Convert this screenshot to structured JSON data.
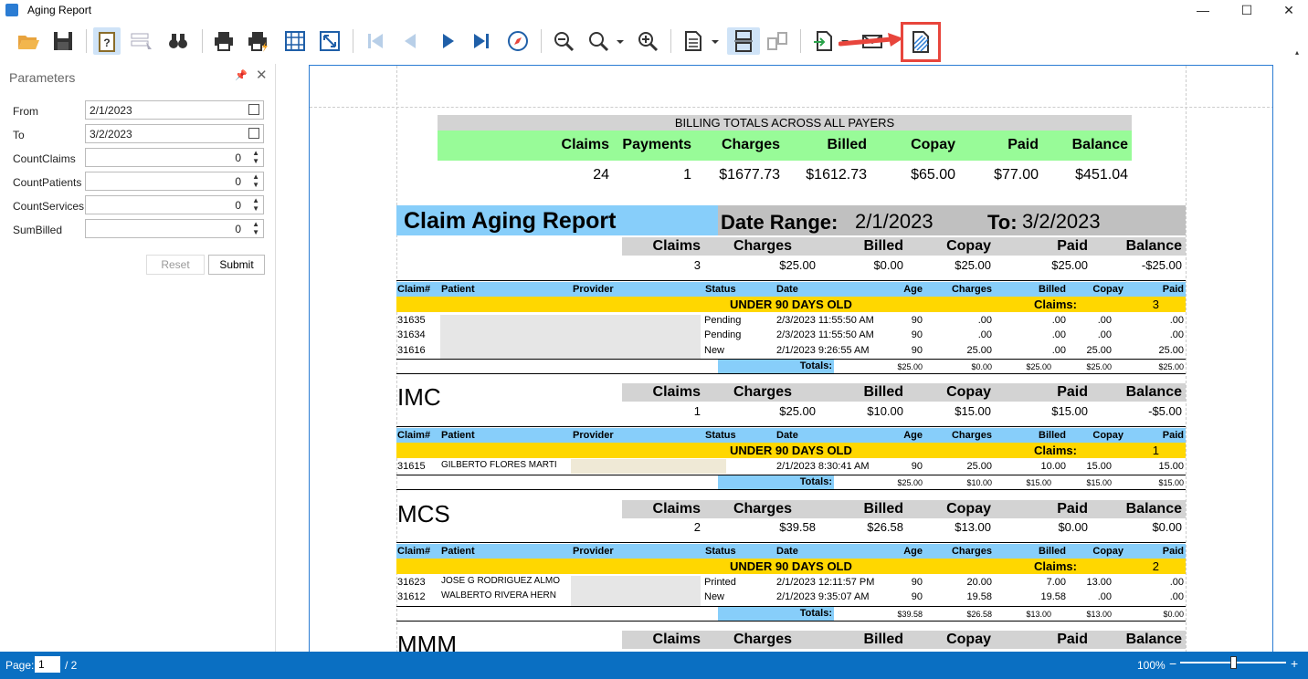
{
  "window": {
    "title": "Aging Report",
    "min": "—",
    "max": "☐",
    "close": "✕"
  },
  "params": {
    "title": "Parameters",
    "pin": "📌",
    "close": "✕",
    "from_label": "From",
    "from_value": "2/1/2023",
    "to_label": "To",
    "to_value": "3/2/2023",
    "countclaims_label": "CountClaims",
    "countclaims_value": "0",
    "countpatients_label": "CountPatients",
    "countpatients_value": "0",
    "countservices_label": "CountServices",
    "countservices_value": "0",
    "sumbilled_label": "SumBilled",
    "sumbilled_value": "0",
    "reset": "Reset",
    "submit": "Submit"
  },
  "report": {
    "billing_title": "BILLING TOTALS ACROSS ALL PAYERS",
    "billing_headers": [
      "Claims",
      "Payments",
      "Charges",
      "Billed",
      "Copay",
      "Paid",
      "Balance"
    ],
    "billing_values": [
      "24",
      "1",
      "$1677.73",
      "$1612.73",
      "$65.00",
      "$77.00",
      "$451.04"
    ],
    "report_title": "Claim Aging Report",
    "date_range_label": "Date Range:",
    "date_from": "2/1/2023",
    "to_label": "To:",
    "date_to": "3/2/2023",
    "sum_headers": [
      "Claims",
      "Charges",
      "Billed",
      "Copay",
      "Paid",
      "Balance"
    ],
    "detail_headers": {
      "claim": "Claim#",
      "patient": "Patient",
      "provider": "Provider",
      "status": "Status",
      "date": "Date",
      "age": "Age",
      "charges": "Charges",
      "billed": "Billed",
      "copay": "Copay",
      "paid": "Paid"
    },
    "band_label": "UNDER 90 DAYS OLD",
    "band_claims_label": "Claims:",
    "totals_label": "Totals:",
    "groups": [
      {
        "name": "",
        "summary": [
          "3",
          "$25.00",
          "$0.00",
          "$25.00",
          "$25.00",
          "-$25.00"
        ],
        "band_count": "3",
        "rows": [
          {
            "claim": "31635",
            "patient": "",
            "status": "Pending",
            "date": "2/3/2023 11:55:50 AM",
            "age": "90",
            "charges": ".00",
            "billed": ".00",
            "copay": ".00",
            "paid": ".00"
          },
          {
            "claim": "31634",
            "patient": "",
            "status": "Pending",
            "date": "2/3/2023 11:55:50 AM",
            "age": "90",
            "charges": ".00",
            "billed": ".00",
            "copay": ".00",
            "paid": ".00"
          },
          {
            "claim": "31616",
            "patient": "",
            "status": "New",
            "date": "2/1/2023 9:26:55 AM",
            "age": "90",
            "charges": "25.00",
            "billed": ".00",
            "copay": "25.00",
            "paid": "25.00"
          }
        ],
        "totals": [
          "$25.00",
          "$0.00",
          "$25.00",
          "$25.00",
          "$25.00"
        ]
      },
      {
        "name": "IMC",
        "summary": [
          "1",
          "$25.00",
          "$10.00",
          "$15.00",
          "$15.00",
          "-$5.00"
        ],
        "band_count": "1",
        "rows": [
          {
            "claim": "31615",
            "patient": "GILBERTO FLORES MARTI",
            "status": "",
            "date": "2/1/2023 8:30:41 AM",
            "age": "90",
            "charges": "25.00",
            "billed": "10.00",
            "copay": "15.00",
            "paid": "15.00"
          }
        ],
        "totals": [
          "$25.00",
          "$10.00",
          "$15.00",
          "$15.00",
          "$15.00"
        ]
      },
      {
        "name": "MCS",
        "summary": [
          "2",
          "$39.58",
          "$26.58",
          "$13.00",
          "$0.00",
          "$0.00"
        ],
        "band_count": "2",
        "rows": [
          {
            "claim": "31623",
            "patient": "JOSE G RODRIGUEZ ALMO",
            "status": "Printed",
            "date": "2/1/2023 12:11:57 PM",
            "age": "90",
            "charges": "20.00",
            "billed": "7.00",
            "copay": "13.00",
            "paid": ".00"
          },
          {
            "claim": "31612",
            "patient": "WALBERTO RIVERA HERN",
            "status": "New",
            "date": "2/1/2023 9:35:07 AM",
            "age": "90",
            "charges": "19.58",
            "billed": "19.58",
            "copay": ".00",
            "paid": ".00"
          }
        ],
        "totals": [
          "$39.58",
          "$26.58",
          "$13.00",
          "$13.00",
          "$0.00"
        ]
      },
      {
        "name": "MMM"
      }
    ]
  },
  "status": {
    "page_label": "Page:",
    "page_value": "1",
    "page_total": "/ 2",
    "zoom": "100%",
    "zoom_minus": "−",
    "zoom_plus": "+"
  },
  "colors": {
    "accent": "#2b7cd3",
    "status_bar": "#0a6fc2",
    "billing_header_bg": "#98fb98",
    "title_bg": "#87cefa",
    "band_bg": "#ffd700",
    "gray": "#d3d3d3",
    "arrow": "#e8453c"
  },
  "icons": [
    "open-folder-icon",
    "save-icon",
    "parameters-icon",
    "select-tool-icon",
    "find-icon",
    "print-icon",
    "quick-print-icon",
    "page-setup-icon",
    "scale-icon",
    "first-page-icon",
    "previous-page-icon",
    "next-page-icon",
    "last-page-icon",
    "navigate-icon",
    "zoom-out-icon",
    "zoom-icon",
    "zoom-in-icon",
    "multiple-pages-icon",
    "continuous-scroll-icon",
    "side-by-side-icon",
    "export-icon",
    "send-email-icon",
    "watermark-icon"
  ]
}
